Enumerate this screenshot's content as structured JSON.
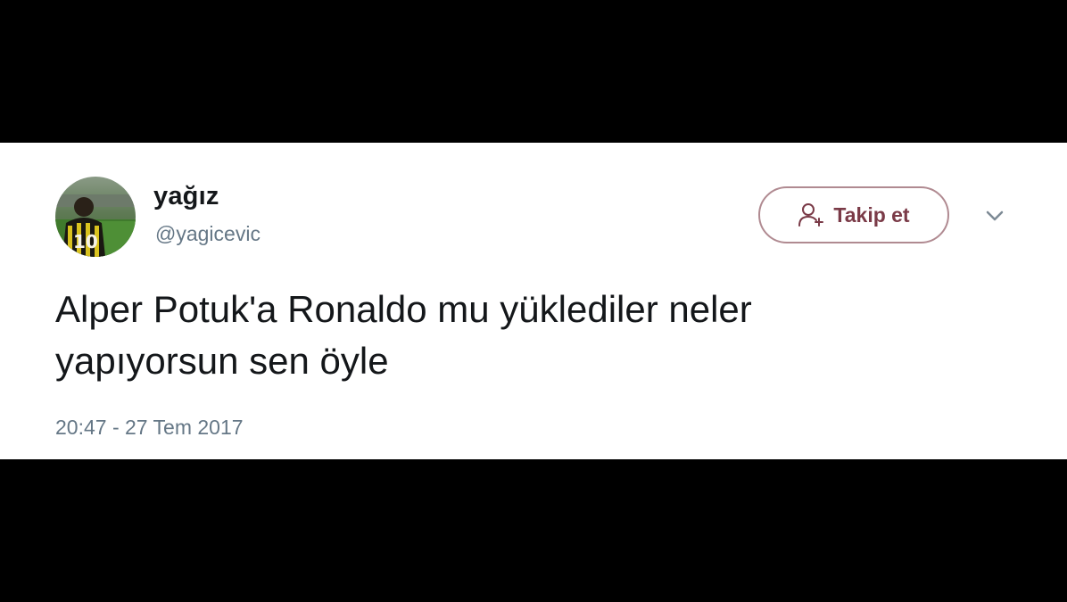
{
  "tweet": {
    "author": {
      "display_name": "yağız",
      "handle": "@yagicevic",
      "avatar_icon": "profile-photo-jersey-10"
    },
    "follow_button": {
      "label": "Takip et",
      "icon": "add-user-icon"
    },
    "menu_icon": "chevron-down-icon",
    "text_line1": "Alper Potuk'a Ronaldo mu yüklediler neler",
    "text_line2": "yapıyorsun sen öyle",
    "timestamp": "20:47 - 27 Tem 2017"
  },
  "colors": {
    "background": "#ffffff",
    "letterbox": "#000000",
    "text": "#14171a",
    "secondary_text": "#657786",
    "follow_border": "#b08a91",
    "follow_text": "#7a3a47"
  }
}
